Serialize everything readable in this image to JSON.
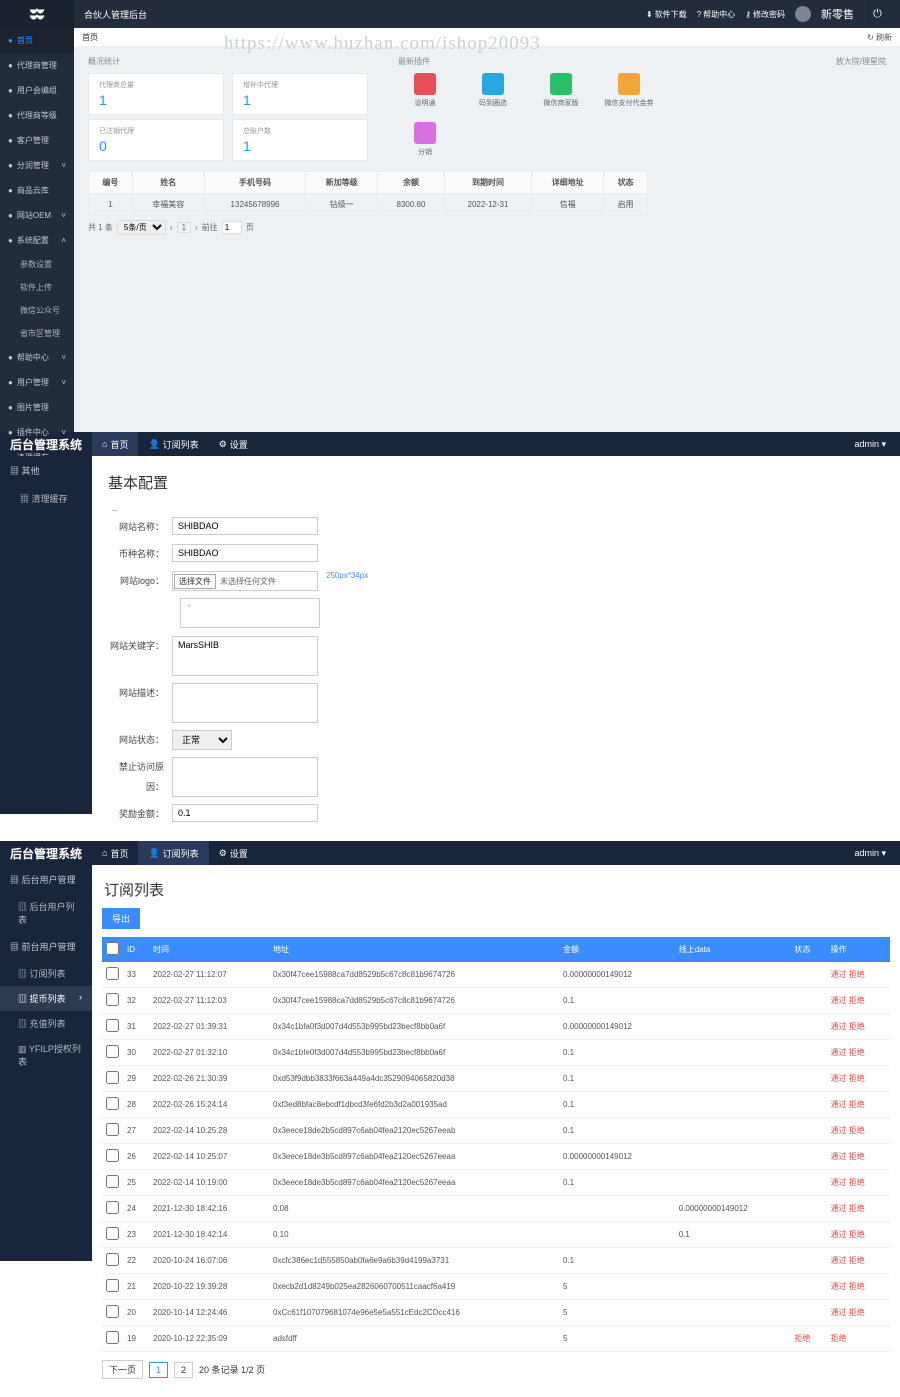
{
  "watermark": "https://www.huzhan.com/ishop20093",
  "p1": {
    "header": {
      "title": "合伙人管理后台",
      "links": [
        "软件下载",
        "帮助中心",
        "修改密码"
      ],
      "username": "新零售"
    },
    "sidebar": [
      {
        "label": "首页",
        "active": true
      },
      {
        "label": "代理商管理"
      },
      {
        "label": "用户会编组"
      },
      {
        "label": "代理商等级"
      },
      {
        "label": "客户管理"
      },
      {
        "label": "分润管理",
        "arrow": true
      },
      {
        "label": "商品云库"
      },
      {
        "label": "网站OEM",
        "arrow": true
      },
      {
        "label": "系统配置",
        "arrow": true,
        "open": true,
        "subs": [
          "参数设置",
          "软件上传",
          "微信公众号",
          "省市区管理"
        ]
      },
      {
        "label": "帮助中心",
        "arrow": true
      },
      {
        "label": "用户管理",
        "arrow": true
      },
      {
        "label": "图片管理"
      },
      {
        "label": "插件中心",
        "arrow": true
      },
      {
        "label": "清理缓存"
      }
    ],
    "breadcrumb": {
      "text": "首页",
      "refresh": "刷新"
    },
    "stats": {
      "title": "概况统计",
      "cards": [
        {
          "label": "代理商总量",
          "value": "1"
        },
        {
          "label": "增补中代理",
          "value": "1"
        },
        {
          "label": "已注销代理",
          "value": "0"
        },
        {
          "label": "总账户数",
          "value": "1"
        }
      ]
    },
    "plugins": {
      "title": "最新插件",
      "items": [
        {
          "name": "设明通",
          "color": "#e94e5a"
        },
        {
          "name": "码到圈选",
          "color": "#2aa7e0"
        },
        {
          "name": "微信商家版",
          "color": "#2bbf6a"
        },
        {
          "name": "微信支付代金券",
          "color": "#f4a53a"
        },
        {
          "name": "分销",
          "color": "#d96fe0"
        }
      ]
    },
    "bigAgentTitle": "放大院/理星院",
    "table": {
      "headers": [
        "编号",
        "姓名",
        "手机号码",
        "新加等级",
        "余额",
        "到期时间",
        "详细地址",
        "状态"
      ],
      "rows": [
        [
          "1",
          "幸福美容",
          "13245678996",
          "钻级一",
          "8300.60",
          "2022-12-31",
          "信福",
          "启用"
        ]
      ]
    },
    "pager": {
      "total": "共 1 条",
      "perPage": "5条/页",
      "pgInput": "1",
      "goto": "前往",
      "gotoInput": "1",
      "suffix": "页"
    }
  },
  "p2": {
    "brand": "后台管理系统",
    "tabs": [
      {
        "label": "首页"
      },
      {
        "label": "订阅列表"
      },
      {
        "label": "设置"
      }
    ],
    "user": "admin",
    "sidebar": [
      {
        "label": "其他",
        "subs": [
          "清理缓存"
        ]
      }
    ],
    "heading": "基本配置",
    "form": {
      "siteName": {
        "label": "网站名称：",
        "value": "SHIBDAO"
      },
      "coinName": {
        "label": "币种名称：",
        "value": "SHIBDAO"
      },
      "siteLogo": {
        "label": "网站logo：",
        "btn": "选择文件",
        "file": "未选择任何文件",
        "tip": "250px*34px"
      },
      "keywords": {
        "label": "网站关键字：",
        "value": "MarsSHIB"
      },
      "intro": {
        "label": "网站描述："
      },
      "status": {
        "label": "网站状态：",
        "value": "正常"
      },
      "forbidReason": {
        "label": "禁止访问原因："
      },
      "reward": {
        "label": "奖励金额：",
        "value": "0.1"
      }
    }
  },
  "p3": {
    "brand": "后台管理系统",
    "tabs": [
      {
        "label": "首页"
      },
      {
        "label": "订阅列表",
        "active": true
      },
      {
        "label": "设置"
      }
    ],
    "user": "admin",
    "sidebar": [
      {
        "label": "后台用户管理",
        "subs": [
          "后台用户列表"
        ]
      },
      {
        "label": "前台用户管理",
        "subs": [
          "订阅列表",
          "提币列表",
          "充值列表",
          "YFILP授权列表"
        ],
        "activeSub": 1
      }
    ],
    "heading": "订阅列表",
    "exportLabel": "导出",
    "table": {
      "headers": [
        "",
        "ID",
        "时间",
        "地址",
        "金额",
        "线上data",
        "状态",
        "操作"
      ],
      "rows": [
        [
          "33",
          "2022-02-27 11:12:07",
          "0x30f47cee15988ca7dd8529b5c67c8c81b9674726",
          "0.00000000149012",
          "",
          "",
          "通过 拒绝"
        ],
        [
          "32",
          "2022-02-27 11:12:03",
          "0x30f47cee15988ca7dd8529b5c67c8c81b9674726",
          "0.1",
          "",
          "",
          "通过 拒绝"
        ],
        [
          "31",
          "2022-02-27 01:39:31",
          "0x34c1bfa0f3d007d4d553b995bd23becf8bb0a6f",
          "0.00000000149012",
          "",
          "",
          "通过 拒绝"
        ],
        [
          "30",
          "2022-02-27 01:32:10",
          "0x34c1bfe0f3d007d4d553b995bd23becf8bb0a6f",
          "0.1",
          "",
          "",
          "通过 拒绝"
        ],
        [
          "29",
          "2022-02-26 21:30:39",
          "0xd53f9dbb3833f663a449a4dc3529094065820d38",
          "0.1",
          "",
          "",
          "通过 拒绝"
        ],
        [
          "28",
          "2022-02-26 15:24:14",
          "0xf3ed8bfac8ebcdf1dbcd3fe6fd2b3d2a001935ad",
          "0.1",
          "",
          "",
          "通过 拒绝"
        ],
        [
          "27",
          "2022-02-14 10:25:28",
          "0x3eece18de2b5cd897c6ab04fea2120ec5267eeab",
          "0.1",
          "",
          "",
          "通过 拒绝"
        ],
        [
          "26",
          "2022-02-14 10:25:07",
          "0x3eece18de3b5cd897c6ab04fea2120ec5267eeaa",
          "0.00000000149012",
          "",
          "",
          "通过 拒绝"
        ],
        [
          "25",
          "2022-02-14 10:19:00",
          "0x3eece18de3b5cd897c6ab04fea2120ec5267eeaa",
          "0.1",
          "",
          "",
          "通过 拒绝"
        ],
        [
          "24",
          "2021-12-30 18:42:16",
          "0.08",
          "",
          "0.00000000149012",
          "",
          "通过 拒绝"
        ],
        [
          "23",
          "2021-12-30 18:42:14",
          "0.10",
          "",
          "0.1",
          "",
          "通过 拒绝"
        ],
        [
          "22",
          "2020-10-24 16:07:06",
          "0xcfc386ec1d555850ab0fa6e9a6b39d4199a3731",
          "0.1",
          "",
          "",
          "通过 拒绝"
        ],
        [
          "21",
          "2020-10-22 19:39:28",
          "0xecb2d1d8249b025ea2826060700511caacf6a419",
          "5",
          "",
          "",
          "通过 拒绝"
        ],
        [
          "20",
          "2020-10-14 12:24:46",
          "0xCc61f107079681074e96e5e5a551cEdc2CDcc416",
          "5",
          "",
          "",
          "通过 拒绝"
        ],
        [
          "19",
          "2020-10-12 22:35:09",
          "adsfdff",
          "5",
          "",
          "拒绝",
          "拒绝"
        ]
      ]
    },
    "pager": {
      "prev": "下一页",
      "pages": [
        "1",
        "2"
      ],
      "summary": "20 条记录 1/2 页"
    }
  }
}
